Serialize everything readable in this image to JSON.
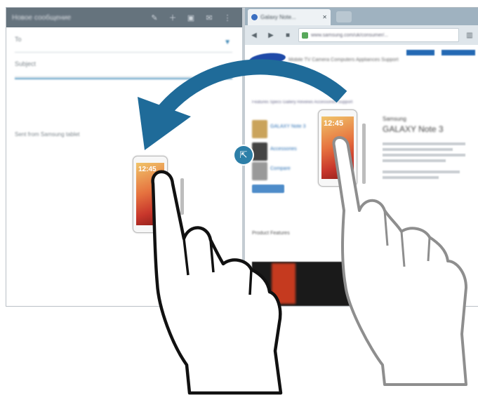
{
  "email": {
    "title": "Новое сообщение",
    "to_label": "To",
    "subject_label": "Subject",
    "signature": "Sent from Samsung tablet",
    "icons": [
      "attach-icon",
      "add-icon",
      "save-icon",
      "send-icon",
      "more-icon"
    ]
  },
  "browser": {
    "tab_title": "Galaxy Note...",
    "url": "www.samsung.com/uk/consumer/...",
    "nav_items": "Mobile  TV  Camera  Computers  Appliances  Support",
    "product_tabs": "Features   Specs   Gallery   Reviews   Accessories   Support",
    "product_brand": "Samsung",
    "product_name": "GALAXY Note 3",
    "thumb_labels": [
      "GALAXY Note 3",
      "Accessories",
      "Compare"
    ],
    "features_label": "Product Features"
  },
  "phone": {
    "clock": "12:45"
  },
  "colors": {
    "arrow": "#1f6b99",
    "drag_icon": "#2d7fa8",
    "email_bar": "#556470"
  }
}
